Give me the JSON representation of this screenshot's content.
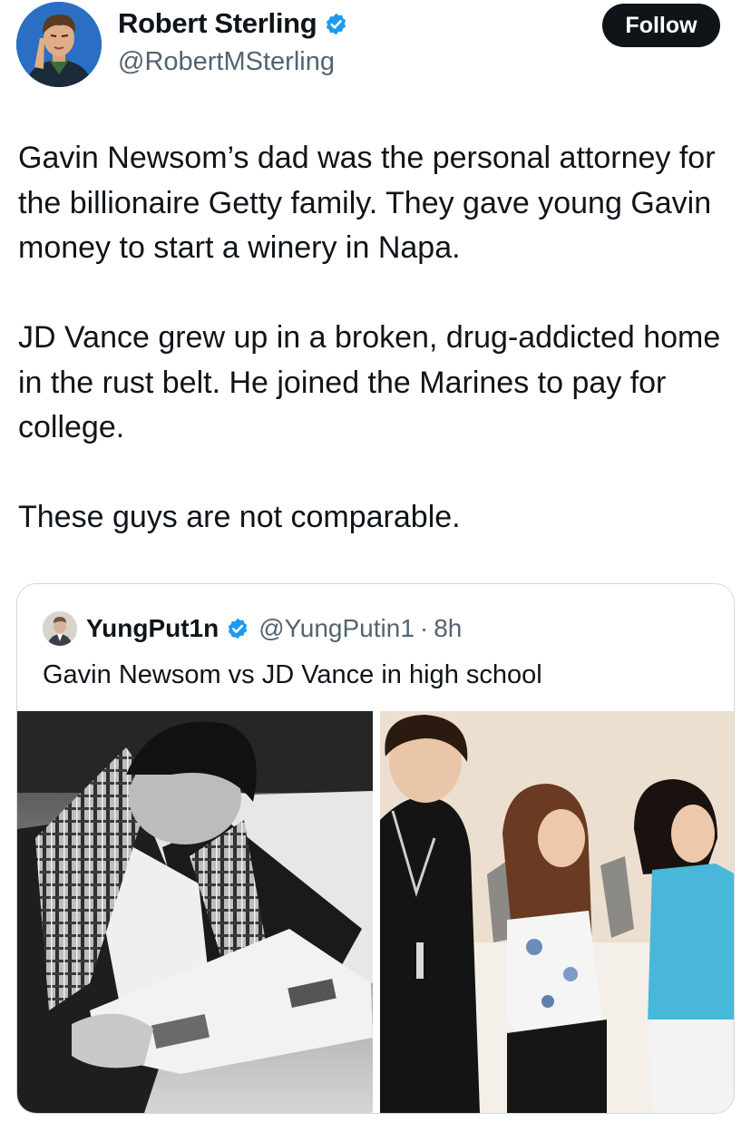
{
  "author": {
    "name": "Robert Sterling",
    "handle": "@RobertMSterling",
    "verified": true,
    "avatar_icon": "cartoon-avatar"
  },
  "follow_label": "Follow",
  "tweet_paragraphs": [
    "Gavin Newsom’s dad was the personal attorney for the billionaire Getty family. They gave young Gavin money to start a winery in Napa.",
    "JD Vance grew up in a broken, drug-addicted home in the rust belt. He joined the Marines to pay for college.",
    "These guys are not comparable."
  ],
  "quoted_tweet": {
    "name": "YungPut1n",
    "handle": "@YungPutin1",
    "separator": "·",
    "time": "8h",
    "verified": true,
    "text": "Gavin Newsom vs JD Vance in high school",
    "images": [
      "black-and-white-photo-young-man-reading-newspaper",
      "color-photo-three-teens-posing"
    ]
  },
  "colors": {
    "verified_blue": "#1d9bf0",
    "text": "#0f1419",
    "secondary_text": "#536471",
    "border": "#cfd9de",
    "follow_button": "#0f1419"
  }
}
